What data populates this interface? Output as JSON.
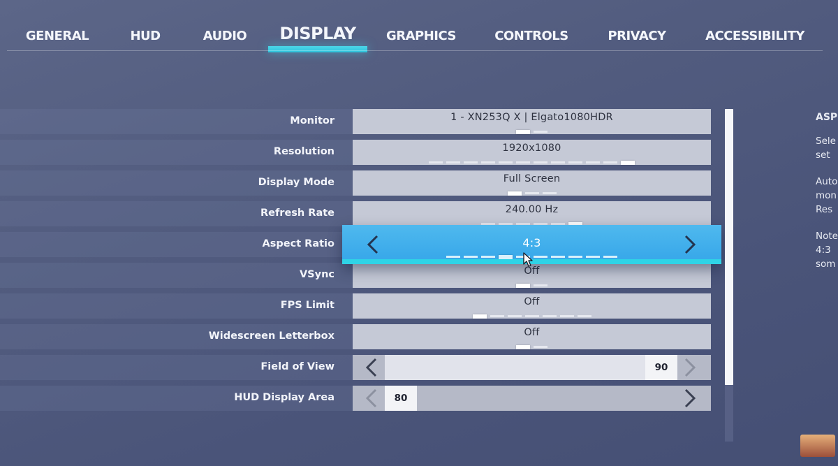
{
  "tabs": [
    {
      "label": "GENERAL",
      "active": false
    },
    {
      "label": "HUD",
      "active": false
    },
    {
      "label": "AUDIO",
      "active": false
    },
    {
      "label": "DISPLAY",
      "active": true
    },
    {
      "label": "GRAPHICS",
      "active": false
    },
    {
      "label": "CONTROLS",
      "active": false
    },
    {
      "label": "PRIVACY",
      "active": false
    },
    {
      "label": "ACCESSIBILITY",
      "active": false
    }
  ],
  "settings": [
    {
      "label": "Monitor",
      "value": "1 - XN253Q X | Elgato1080HDR",
      "option_count": 2,
      "selected_index": 0
    },
    {
      "label": "Resolution",
      "value": "1920x1080",
      "option_count": 12,
      "selected_index": 11
    },
    {
      "label": "Display Mode",
      "value": "Full Screen",
      "option_count": 3,
      "selected_index": 0
    },
    {
      "label": "Refresh Rate",
      "value": "240.00 Hz",
      "option_count": 6,
      "selected_index": 5
    },
    {
      "label": "Aspect Ratio",
      "value": "4:3",
      "option_count": 10,
      "selected_index": 3,
      "focused": true
    },
    {
      "label": "VSync",
      "value": "Off",
      "option_count": 2,
      "selected_index": 0
    },
    {
      "label": "FPS Limit",
      "value": "Off",
      "option_count": 7,
      "selected_index": 0
    },
    {
      "label": "Widescreen Letterbox",
      "value": "Off",
      "option_count": 2,
      "selected_index": 0
    }
  ],
  "sliders": [
    {
      "label": "Field of View",
      "value": "90",
      "fraction": 1.0
    },
    {
      "label": "HUD Display Area",
      "value": "80",
      "fraction": 0.0
    }
  ],
  "scrollbar": {
    "position_fraction": 0.0,
    "visible_fraction": 0.83
  },
  "side_panel": {
    "title": "ASP",
    "lines": [
      "Sele",
      "set",
      "Auto",
      "mon",
      "Res",
      "Note",
      "4:3",
      "som"
    ]
  },
  "icons": {
    "prev": "chevron-left-icon",
    "next": "chevron-right-icon",
    "cursor": "mouse-pointer-icon"
  },
  "colors": {
    "accent": "#2fd3e6",
    "focus": "#3aa9ea",
    "field": "#c5c9d6"
  }
}
